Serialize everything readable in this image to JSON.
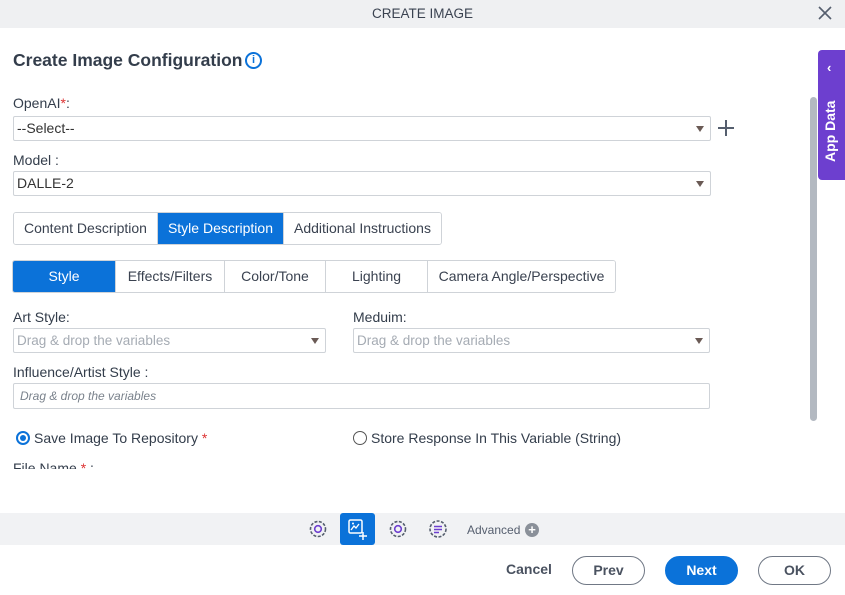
{
  "window": {
    "title": "CREATE IMAGE"
  },
  "header": {
    "title": "Create Image Configuration"
  },
  "form": {
    "openai_label": "OpenAI",
    "openai_req": "*",
    "openai_colon": ":",
    "openai_value": "--Select--",
    "model_label": "Model :",
    "model_value": "DALLE-2"
  },
  "tabs_primary": [
    {
      "label": "Content Description",
      "active": false
    },
    {
      "label": "Style Description",
      "active": true
    },
    {
      "label": "Additional Instructions",
      "active": false
    }
  ],
  "tabs_secondary": [
    {
      "label": "Style",
      "active": true
    },
    {
      "label": "Effects/Filters",
      "active": false
    },
    {
      "label": "Color/Tone",
      "active": false
    },
    {
      "label": "Lighting",
      "active": false
    },
    {
      "label": "Camera Angle/Perspective",
      "active": false
    }
  ],
  "style": {
    "art_style_label": "Art Style:",
    "art_style_placeholder": "Drag & drop the variables",
    "medium_label": "Meduim:",
    "medium_placeholder": "Drag & drop the variables",
    "influence_label": "Influence/Artist Style :",
    "influence_placeholder": "Drag & drop the variables"
  },
  "output": {
    "save_repo_label": "Save Image To Repository",
    "save_repo_req": "*",
    "save_repo_checked": true,
    "store_var_label": "Store Response In This Variable (String)",
    "store_var_checked": false,
    "file_name_label": "File Name",
    "file_name_req": "*",
    "file_name_colon": " :"
  },
  "side_panel": {
    "label": "App Data"
  },
  "toolbar": {
    "advanced_label": "Advanced"
  },
  "footer": {
    "cancel": "Cancel",
    "prev": "Prev",
    "next": "Next",
    "ok": "OK"
  },
  "colors": {
    "primary": "#0b72d9",
    "app_data": "#6d3fcf",
    "required": "#dd3333"
  }
}
